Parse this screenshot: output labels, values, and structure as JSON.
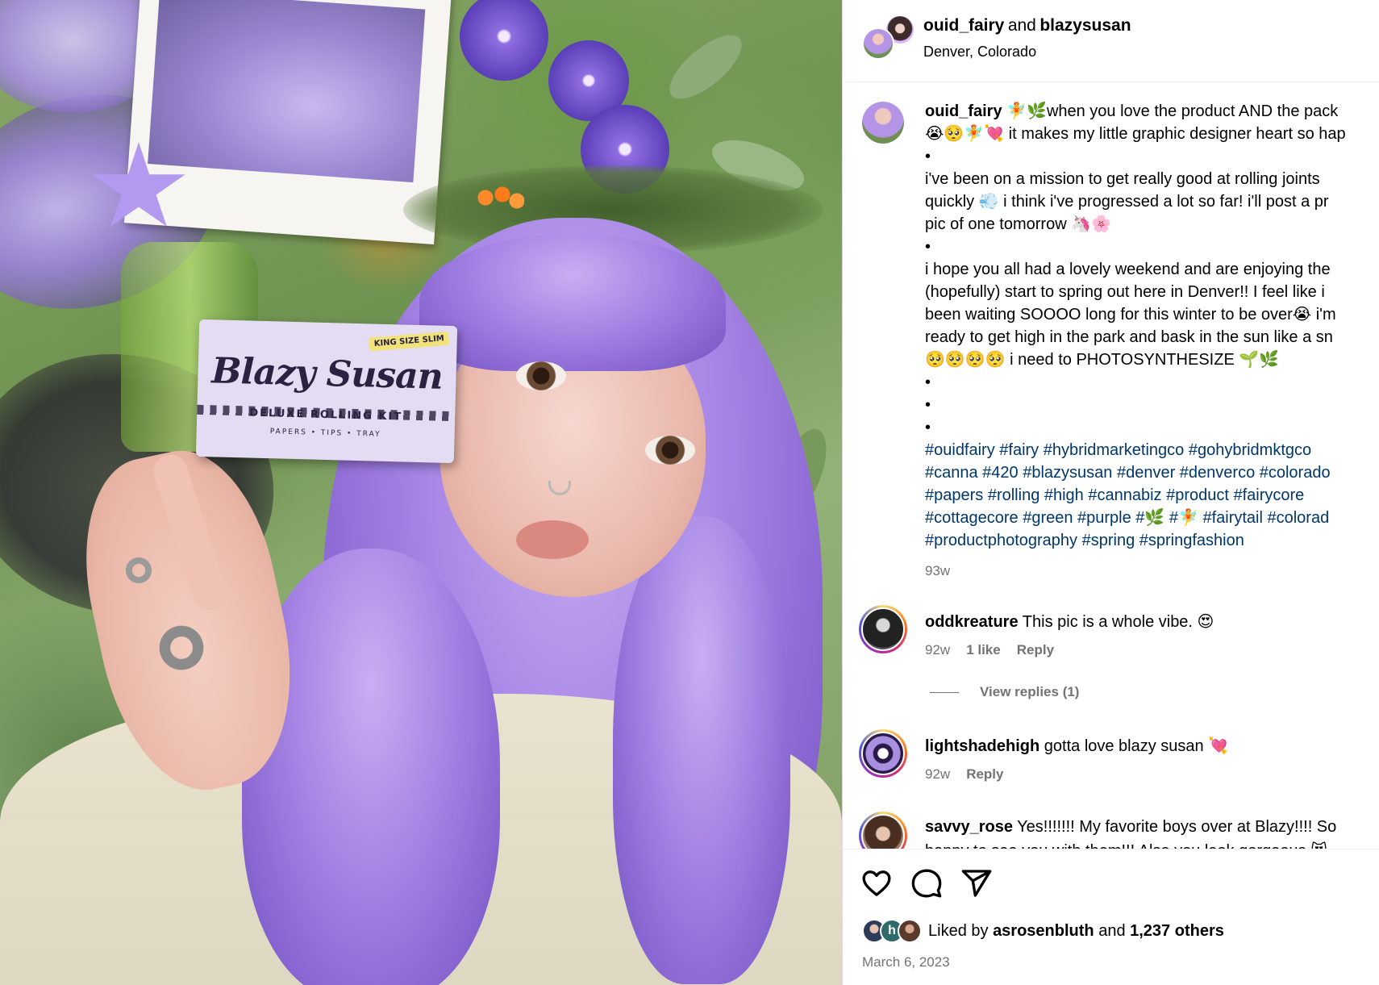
{
  "photo": {
    "product_brand": "Blazy Susan",
    "product_title": "DELUXE ROLLING KIT",
    "product_subtitle": "PAPERS • TIPS • TRAY",
    "product_tag": "KING SIZE SLIM"
  },
  "header": {
    "user1": "ouid_fairy",
    "and_text": "and",
    "user2": "blazysusan",
    "location": "Denver, Colorado"
  },
  "caption": {
    "username": "ouid_fairy",
    "lines": [
      " 🧚🌿when you love the product AND the pack",
      "😭🥺🧚💘 it makes my little graphic designer heart so hap",
      "•",
      "i've been on a mission to get really good at rolling joints",
      "quickly 💨 i think i've progressed a lot so far! i'll post a pr",
      "pic of one tomorrow 🦄🌸",
      "•",
      "i hope you all had a lovely weekend and are enjoying the",
      "(hopefully) start to spring out here in Denver!! I feel like i",
      "been waiting SOOOO long for this winter to be over😭 i'm",
      "ready to get high in the park and bask in the sun like a sn",
      "🥺🥺🥺🥺 i need to PHOTOSYNTHESIZE 🌱🌿",
      "•",
      "•",
      "•"
    ],
    "hashtags": [
      "#ouidfairy #fairy #hybridmarketingco #gohybridmktgco",
      "#canna #420 #blazysusan #denver #denverco #colorado",
      "#papers #rolling #high #cannabiz #product #fairycore",
      "#cottagecore #green #purple #🌿 #🧚 #fairytail #colorad",
      "#productphotography #spring #springfashion"
    ],
    "age": "93w"
  },
  "comments": [
    {
      "user": "oddkreature",
      "text": " This pic is a whole vibe. 😍",
      "age": "92w",
      "likes": "1 like",
      "reply": "Reply",
      "view_replies": "View replies (1)"
    },
    {
      "user": "lightshadehigh",
      "text": " gotta love blazy susan 💘",
      "age": "92w",
      "reply": "Reply"
    },
    {
      "user": "savvy_rose",
      "text": " Yes!!!!!!! My favorite boys over at Blazy!!!! So",
      "text2": "happy to see you with them!!! Also you look gorgeous 😻"
    }
  ],
  "footer": {
    "liked_by_prefix": "Liked by ",
    "liked_by_user": "asrosenbluth",
    "liked_and": " and ",
    "liked_others": "1,237 others",
    "date": "March 6, 2023"
  },
  "icons": [
    "heart-icon",
    "comment-icon",
    "share-icon"
  ]
}
